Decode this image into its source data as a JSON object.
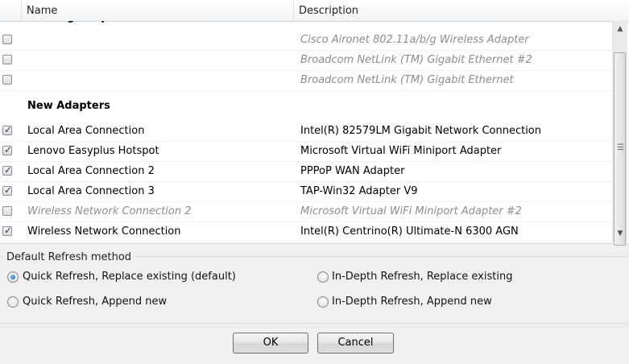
{
  "columns": {
    "name": "Name",
    "description": "Description"
  },
  "partial_group_title": "Existing Adapters",
  "existing_adapters": [
    {
      "checked": false,
      "disabled": true,
      "name": "",
      "description": "Cisco Aironet 802.11a/b/g Wireless Adapter"
    },
    {
      "checked": false,
      "disabled": true,
      "name": "",
      "description": "Broadcom NetLink (TM) Gigabit Ethernet #2"
    },
    {
      "checked": false,
      "disabled": true,
      "name": "",
      "description": "Broadcom NetLink (TM) Gigabit Ethernet"
    }
  ],
  "new_adapters_title": "New Adapters",
  "new_adapters": [
    {
      "checked": true,
      "disabled": false,
      "name": "Local Area Connection",
      "description": "Intel(R) 82579LM Gigabit Network Connection"
    },
    {
      "checked": true,
      "disabled": false,
      "name": "Lenovo Easyplus Hotspot",
      "description": "Microsoft Virtual WiFi Miniport Adapter"
    },
    {
      "checked": true,
      "disabled": false,
      "name": "Local Area Connection 2",
      "description": "PPPoP WAN Adapter"
    },
    {
      "checked": true,
      "disabled": false,
      "name": "Local Area Connection 3",
      "description": "TAP-Win32 Adapter V9"
    },
    {
      "checked": false,
      "disabled": true,
      "name": "Wireless Network Connection 2",
      "description": "Microsoft Virtual WiFi Miniport Adapter #2"
    },
    {
      "checked": true,
      "disabled": false,
      "name": "Wireless Network Connection",
      "description": "Intel(R) Centrino(R) Ultimate-N 6300 AGN"
    }
  ],
  "refresh": {
    "title": "Default Refresh method",
    "options": [
      {
        "label": "Quick Refresh, Replace existing (default)",
        "selected": true
      },
      {
        "label": "In-Depth Refresh, Replace existing",
        "selected": false
      },
      {
        "label": "Quick Refresh, Append new",
        "selected": false
      },
      {
        "label": "In-Depth Refresh, Append new",
        "selected": false
      }
    ]
  },
  "buttons": {
    "ok": "OK",
    "cancel": "Cancel"
  },
  "colors": {
    "accent": "#1a5fc4",
    "disabled_text": "#8d8d8d"
  }
}
